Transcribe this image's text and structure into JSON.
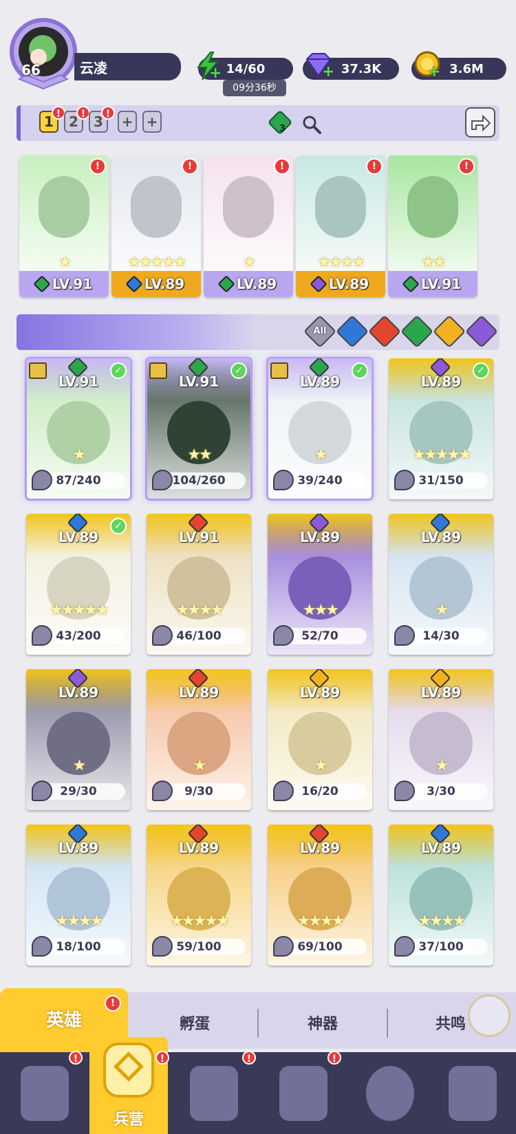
{
  "player": {
    "level": "66",
    "name": "云凌"
  },
  "resources": {
    "energy": {
      "value": "14/60",
      "timer": "09分36秒",
      "icon": "lightning-icon"
    },
    "gems": {
      "value": "37.3K",
      "icon": "diamond-icon"
    },
    "gold": {
      "value": "3.6M",
      "icon": "coin-icon"
    }
  },
  "teams": {
    "tabs": [
      "1",
      "2",
      "3",
      "+",
      "+"
    ],
    "active_index": 0,
    "element_count": "3"
  },
  "team_heroes": [
    {
      "level": "LV.91",
      "stars": "★",
      "element": "nature",
      "bg": "#c8f0c0",
      "strip": "#b9a6f0"
    },
    {
      "level": "LV.89",
      "stars": "★★★★★",
      "element": "water",
      "bg": "#e3e7ee",
      "strip": "#f0a81e"
    },
    {
      "level": "LV.89",
      "stars": "★",
      "element": "nature",
      "bg": "#f4e2ee",
      "strip": "#b9a6f0"
    },
    {
      "level": "LV.89",
      "stars": "★★★★",
      "element": "dark",
      "bg": "#c8e8e2",
      "strip": "#f0a81e"
    },
    {
      "level": "LV.91",
      "stars": "★★",
      "element": "nature",
      "bg": "#a8e6a0",
      "strip": "#b9a6f0"
    }
  ],
  "filters": [
    {
      "label": "All",
      "color": "#9a98ad"
    },
    {
      "label": "",
      "color": "#2f78d8"
    },
    {
      "label": "",
      "color": "#e3452f"
    },
    {
      "label": "",
      "color": "#2ba64d"
    },
    {
      "label": "",
      "color": "#f2b21f"
    },
    {
      "label": "",
      "color": "#8a5ad8"
    }
  ],
  "heroes": [
    {
      "level": "LV.91",
      "shards": "87/240",
      "stars": "★",
      "element_color": "#2ba64d",
      "checked": true,
      "rank": true,
      "selected": true,
      "bg": "#c4e8b8",
      "top": "#c8b8f4"
    },
    {
      "level": "LV.91",
      "shards": "104/260",
      "stars": "★★",
      "element_color": "#2ba64d",
      "checked": true,
      "rank": true,
      "selected": true,
      "bg": "#344a3a",
      "top": "#c8b8f4"
    },
    {
      "level": "LV.89",
      "shards": "39/240",
      "stars": "★",
      "element_color": "#2ba64d",
      "checked": true,
      "rank": true,
      "selected": true,
      "bg": "#eaf0f4",
      "top": "#c8b8f4"
    },
    {
      "level": "LV.89",
      "shards": "31/150",
      "stars": "★★★★★",
      "element_color": "#8a5ad8",
      "checked": true,
      "rank": false,
      "selected": false,
      "bg": "#b8dcd8",
      "top": "#f2c51d"
    },
    {
      "level": "LV.89",
      "shards": "43/200",
      "stars": "★★★★★",
      "element_color": "#2f78d8",
      "checked": true,
      "rank": false,
      "selected": false,
      "bg": "#f0ecd8",
      "top": "#f2c51d"
    },
    {
      "level": "LV.91",
      "shards": "46/100",
      "stars": "★★★★",
      "element_color": "#e3452f",
      "checked": false,
      "rank": false,
      "selected": false,
      "bg": "#e8d8b0",
      "top": "#f2c51d"
    },
    {
      "level": "LV.89",
      "shards": "52/70",
      "stars": "★★★",
      "element_color": "#8a5ad8",
      "checked": false,
      "rank": false,
      "selected": false,
      "bg": "#8a6ad0",
      "top": "#f2c51d"
    },
    {
      "level": "LV.89",
      "shards": "14/30",
      "stars": "★",
      "element_color": "#2f78d8",
      "checked": false,
      "rank": false,
      "selected": false,
      "bg": "#c8dcec",
      "top": "#f2c51d"
    },
    {
      "level": "LV.89",
      "shards": "29/30",
      "stars": "★",
      "element_color": "#8a5ad8",
      "checked": false,
      "rank": false,
      "selected": false,
      "bg": "#7c7a94",
      "top": "#f2c51d"
    },
    {
      "level": "LV.89",
      "shards": "9/30",
      "stars": "★",
      "element_color": "#e3452f",
      "checked": false,
      "rank": false,
      "selected": false,
      "bg": "#f4b890",
      "top": "#f2c51d"
    },
    {
      "level": "LV.89",
      "shards": "16/20",
      "stars": "★",
      "element_color": "#f2b21f",
      "checked": false,
      "rank": false,
      "selected": false,
      "bg": "#f0e2b0",
      "top": "#f2c51d"
    },
    {
      "level": "LV.89",
      "shards": "3/30",
      "stars": "★",
      "element_color": "#f2b21f",
      "checked": false,
      "rank": false,
      "selected": false,
      "bg": "#dcd0e8",
      "top": "#f2c51d"
    },
    {
      "level": "LV.89",
      "shards": "18/100",
      "stars": "★★★★",
      "element_color": "#2f78d8",
      "checked": false,
      "rank": false,
      "selected": false,
      "bg": "#c4dcf0",
      "top": "#f2c51d"
    },
    {
      "level": "LV.89",
      "shards": "59/100",
      "stars": "★★★★★",
      "element_color": "#e3452f",
      "checked": false,
      "rank": false,
      "selected": false,
      "bg": "#f4c860",
      "top": "#f2c51d"
    },
    {
      "level": "LV.89",
      "shards": "69/100",
      "stars": "★★★★",
      "element_color": "#e3452f",
      "checked": false,
      "rank": false,
      "selected": false,
      "bg": "#f4c060",
      "top": "#f2c51d"
    },
    {
      "level": "LV.89",
      "shards": "37/100",
      "stars": "★★★★",
      "element_color": "#2f78d8",
      "checked": false,
      "rank": false,
      "selected": false,
      "bg": "#a8d8d0",
      "top": "#f2c51d"
    }
  ],
  "tabs": {
    "hero": "英雄",
    "hatch": "孵蛋",
    "artifact": "神器",
    "resonance": "共鸣"
  },
  "nav": {
    "barracks": "兵营"
  }
}
